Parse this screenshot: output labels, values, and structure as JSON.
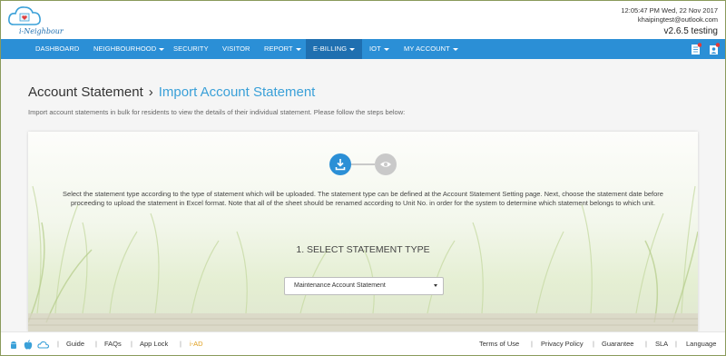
{
  "app": {
    "logo_text": "i-Neighbour"
  },
  "header": {
    "time": "12:05:47 PM  Wed, 22 Nov 2017",
    "email": "khaipingtest@outlook.com",
    "version": "v2.6.5 testing"
  },
  "nav": {
    "items": [
      {
        "label": "DASHBOARD",
        "dropdown": false
      },
      {
        "label": "NEIGHBOURHOOD",
        "dropdown": true
      },
      {
        "label": "SECURITY",
        "dropdown": false
      },
      {
        "label": "VISITOR",
        "dropdown": false
      },
      {
        "label": "REPORT",
        "dropdown": true
      },
      {
        "label": "E-BILLING",
        "dropdown": true,
        "active": true
      },
      {
        "label": "IOT",
        "dropdown": true
      },
      {
        "label": "MY ACCOUNT",
        "dropdown": true
      }
    ],
    "icons": [
      "document-notification-icon",
      "user-notification-icon"
    ]
  },
  "page": {
    "breadcrumb_root": "Account Statement",
    "breadcrumb_current": "Import Account Statement",
    "intro": "Import account statements in bulk for residents to view the details of their individual statement. Please follow the steps below:",
    "description": "Select the statement type according to the type of statement which will be uploaded. The statement type can be defined at the Account Statement Setting page. Next, choose the statement date before proceeding to upload the statement in Excel format. Note that all of the sheet should be renamed according to Unit No. in order for the system to determine which statement belongs to which unit.",
    "section_title": "1. SELECT STATEMENT TYPE",
    "statement_type_selected": "Maintenance Account Statement",
    "steps": [
      {
        "icon": "download-icon",
        "state": "active"
      },
      {
        "icon": "eye-icon",
        "state": "inactive"
      }
    ]
  },
  "footer": {
    "app_icons": [
      "android-icon",
      "apple-icon",
      "cloud-icon"
    ],
    "links_left": [
      "Guide",
      "FAQs",
      "App Lock",
      "i-AD"
    ],
    "links_right": [
      "Terms of Use",
      "Privacy Policy",
      "Guarantee",
      "SLA",
      "Language"
    ]
  },
  "colors": {
    "primary": "#2b8fd6",
    "active_nav": "#1f6fb0",
    "accent_link": "#3aa0d8",
    "iad": "#e0a020"
  }
}
